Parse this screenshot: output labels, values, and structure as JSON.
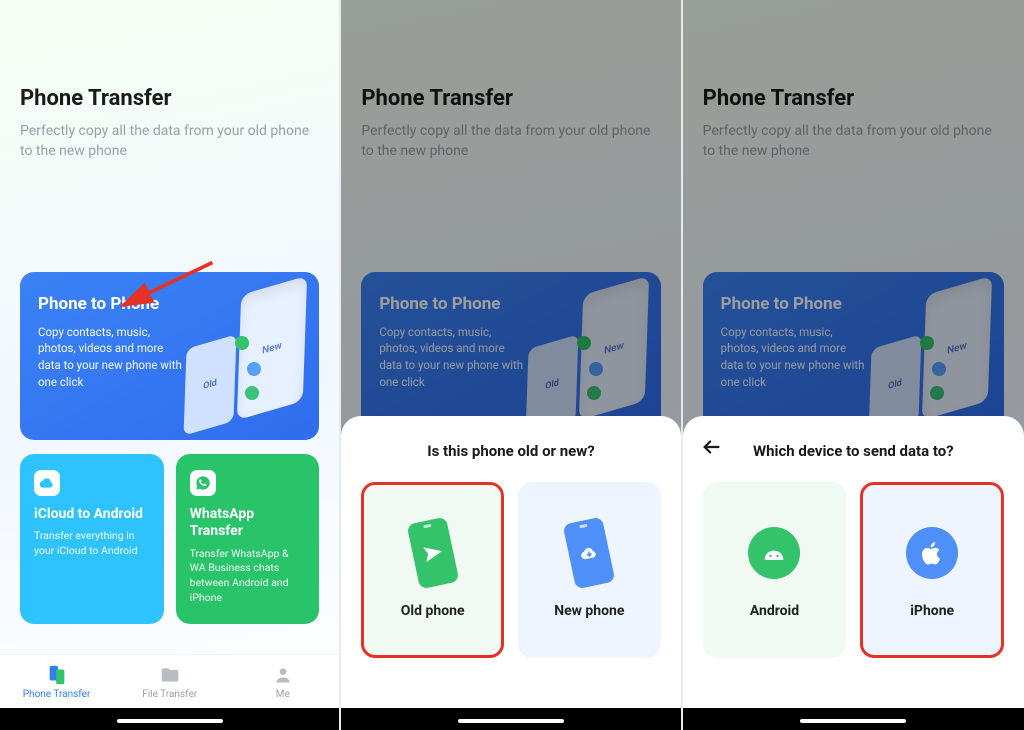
{
  "header": {
    "title": "Phone Transfer",
    "subtitle": "Perfectly copy all the data from your old phone to the new phone"
  },
  "card_big": {
    "title": "Phone to Phone",
    "desc": "Copy contacts, music, photos, videos and more data to your new phone with one click",
    "new_label": "New",
    "old_label": "Old"
  },
  "card_icloud": {
    "title": "iCloud to Android",
    "desc": "Transfer everything in your iCloud to Android"
  },
  "card_whatsapp": {
    "title": "WhatsApp Transfer",
    "desc": "Transfer WhatsApp & WA Business chats between Android and iPhone"
  },
  "tabs": {
    "transfer": "Phone Transfer",
    "file": "File Transfer",
    "me": "Me"
  },
  "sheet_oldnew": {
    "title": "Is this phone old or new?",
    "old": "Old phone",
    "new": "New phone"
  },
  "sheet_target": {
    "title": "Which device to send data to?",
    "android": "Android",
    "iphone": "iPhone"
  },
  "colors": {
    "accent_blue": "#2f7ef6",
    "accent_green": "#29c36a",
    "accent_cyan": "#2ec3ff",
    "highlight_red": "#e53226"
  }
}
